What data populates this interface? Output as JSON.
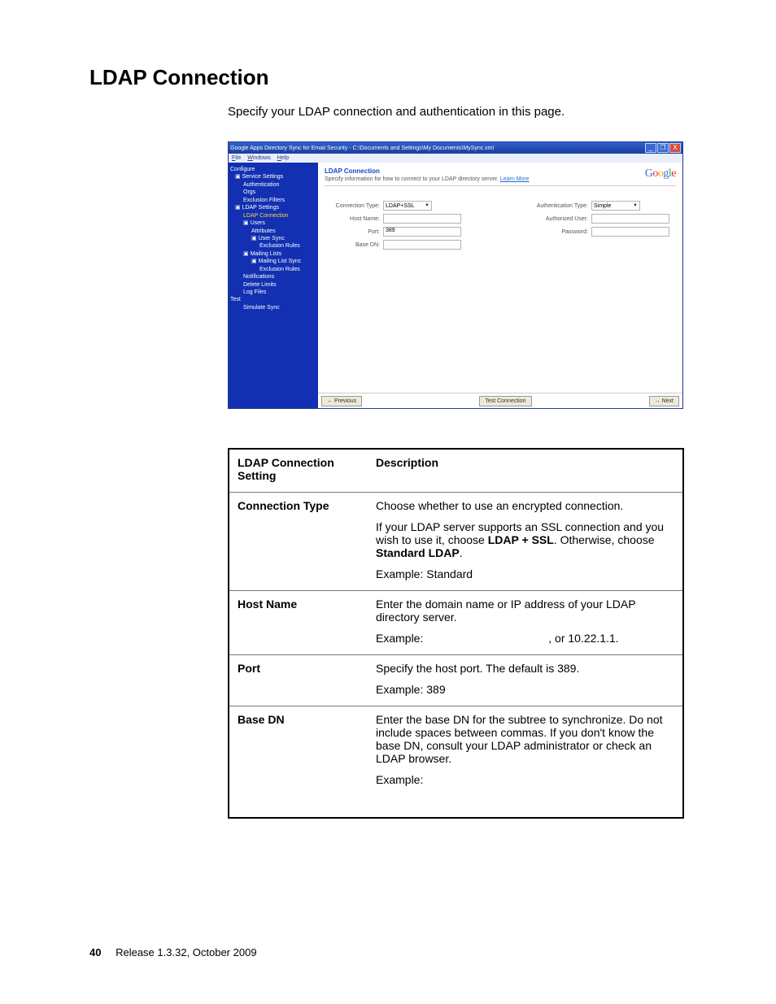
{
  "heading": "LDAP Connection",
  "intro": "Specify your LDAP connection and authentication in this page.",
  "window": {
    "title": "Google Apps Directory Sync for Email Security - C:\\Documents and Settings\\My Documents\\MySync.xml",
    "menu": {
      "file": "File",
      "windows": "Windows",
      "help": "Help"
    },
    "nav": {
      "configure": "Configure",
      "service_settings": "Service Settings",
      "authentication": "Authentication",
      "orgs": "Orgs",
      "exclusion_filters": "Exclusion Filters",
      "ldap_settings": "LDAP Settings",
      "ldap_connection": "LDAP Connection",
      "users": "Users",
      "attributes": "Attributes",
      "user_sync": "User Sync",
      "exclusion_rules_users": "Exclusion Rules",
      "mailing_lists": "Mailing Lists",
      "mailing_list_sync": "Mailing List Sync",
      "exclusion_rules_ml": "Exclusion Rules",
      "notifications": "Notifications",
      "delete_limits": "Delete Limits",
      "log_files": "Log Files",
      "test": "Test",
      "simulate_sync": "Simulate Sync"
    },
    "content": {
      "title": "LDAP Connection",
      "subtitle_pre": "Specify information for how to connect to your LDAP directory server. ",
      "learn_more": "Learn More",
      "left_labels": {
        "ctype": "Connection Type:",
        "host": "Host Name:",
        "port": "Port:",
        "basedn": "Base DN:"
      },
      "right_labels": {
        "atype": "Authentication Type:",
        "auser": "Authorized User:",
        "pwd": "Password:"
      },
      "values": {
        "ctype": "LDAP+SSL",
        "port": "389",
        "atype": "Simple"
      }
    },
    "buttons": {
      "prev": "← Previous",
      "test": "Test Connection",
      "next": "→ Next"
    },
    "ctrl": {
      "min": "_",
      "max": "❐",
      "close": "X"
    }
  },
  "table": {
    "header": {
      "c1a": "LDAP Connection",
      "c1b": "Setting",
      "c2": "Description"
    },
    "rows": {
      "ctype": {
        "label": "Connection Type",
        "p1": "Choose whether to use an encrypted connection.",
        "p2_pre": "If your LDAP server supports an SSL connection and you wish to use it, choose ",
        "p2_b1": "LDAP + SSL",
        "p2_mid": ". Otherwise, choose ",
        "p2_b2": "Standard LDAP",
        "p2_post": ".",
        "p3": "Example: Standard"
      },
      "host": {
        "label": "Host Name",
        "p1": "Enter the domain name or IP address of your LDAP directory server.",
        "p2_pre": "Example: ",
        "p2_post": ", or 10.22.1.1."
      },
      "port": {
        "label": "Port",
        "p1": "Specify the host port. The default is 389.",
        "p2": "Example: 389"
      },
      "basedn": {
        "label": "Base DN",
        "p1": "Enter the base DN for the subtree to synchronize. Do not include spaces between commas. If you don't know the base DN, consult your LDAP administrator or check an LDAP browser.",
        "p2": "Example:"
      }
    }
  },
  "footer": {
    "pagenum": "40",
    "release": "Release 1.3.32, October 2009"
  }
}
